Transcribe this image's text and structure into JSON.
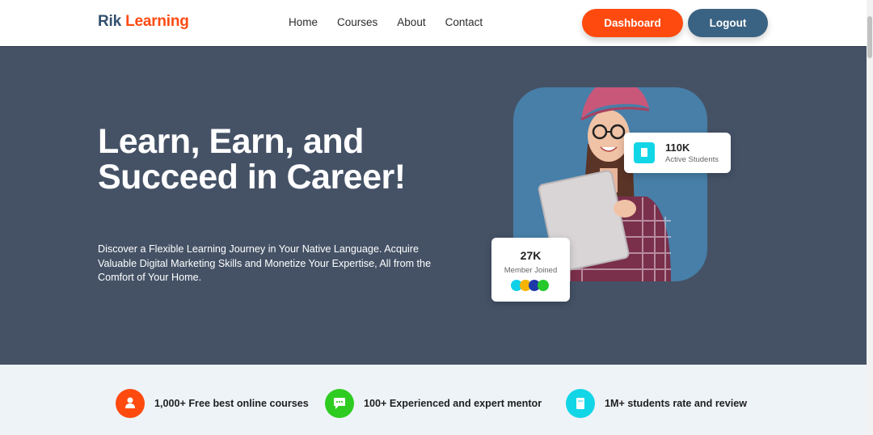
{
  "header": {
    "logo_part1": "Rik",
    "logo_part2": "Learning",
    "nav": [
      "Home",
      "Courses",
      "About",
      "Contact"
    ],
    "dashboard_label": "Dashboard",
    "logout_label": "Logout"
  },
  "hero": {
    "title": "Learn, Earn, and Succeed in Career!",
    "description": "Discover a Flexible Learning Journey in Your Native Language. Acquire Valuable Digital Marketing Skills and Monetize Your Expertise, All from the Comfort of Your Home."
  },
  "stats": {
    "students_value": "110K",
    "students_label": "Active Students",
    "members_value": "27K",
    "members_label": "Member Joined",
    "member_dot_colors": [
      "#10d0e8",
      "#f5b400",
      "#1f3aa8",
      "#26c92c"
    ]
  },
  "features": [
    {
      "text": "1,000+ Free best online courses",
      "icon": "person-icon",
      "color": "#ff4a0f"
    },
    {
      "text": "100+ Experienced and expert mentor",
      "icon": "chat-icon",
      "color": "#2ecc20"
    },
    {
      "text": "1M+ students rate and review",
      "icon": "book-icon",
      "color": "#12d6e6"
    }
  ],
  "colors": {
    "brand_dark": "#334f6e",
    "brand_orange": "#ff4a12",
    "hero_bg": "#455266",
    "card_blue": "#477fa8"
  }
}
